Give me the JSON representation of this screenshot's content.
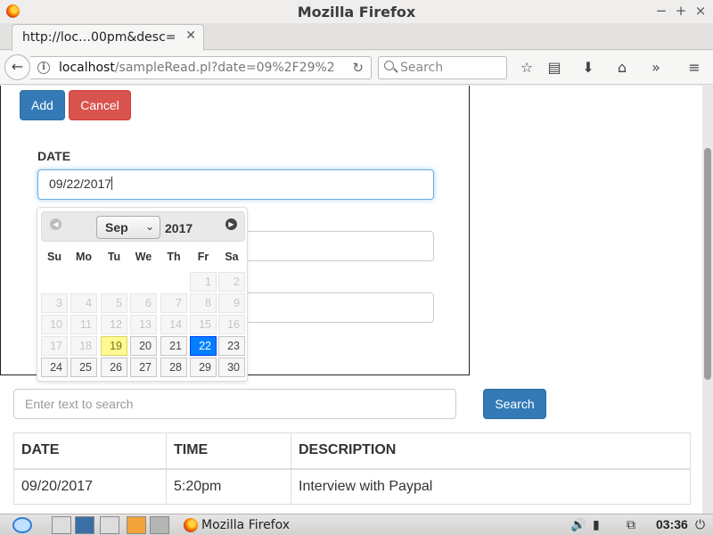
{
  "window": {
    "title": "Mozilla Firefox"
  },
  "tab": {
    "label": "http://loc…00pm&desc="
  },
  "urlbar": {
    "host": "localhost",
    "path": "/sampleRead.pl?date=09%2F29%2"
  },
  "searchbar": {
    "placeholder": "Search"
  },
  "form": {
    "add_label": "Add",
    "cancel_label": "Cancel",
    "date_label": "DATE",
    "date_value": "09/22/2017"
  },
  "datepicker": {
    "month": "Sep",
    "year": "2017",
    "weekdays": [
      "Su",
      "Mo",
      "Tu",
      "We",
      "Th",
      "Fr",
      "Sa"
    ],
    "rows": [
      [
        null,
        null,
        null,
        null,
        null,
        {
          "d": "1"
        },
        {
          "d": "2"
        }
      ],
      [
        {
          "d": "3"
        },
        {
          "d": "4"
        },
        {
          "d": "5"
        },
        {
          "d": "6"
        },
        {
          "d": "7"
        },
        {
          "d": "8"
        },
        {
          "d": "9"
        }
      ],
      [
        {
          "d": "10"
        },
        {
          "d": "11"
        },
        {
          "d": "12"
        },
        {
          "d": "13"
        },
        {
          "d": "14"
        },
        {
          "d": "15"
        },
        {
          "d": "16"
        }
      ],
      [
        {
          "d": "17"
        },
        {
          "d": "18"
        },
        {
          "d": "19",
          "state": "today"
        },
        {
          "d": "20",
          "state": "enabled"
        },
        {
          "d": "21",
          "state": "enabled"
        },
        {
          "d": "22",
          "state": "selected"
        },
        {
          "d": "23",
          "state": "enabled"
        }
      ],
      [
        {
          "d": "24",
          "state": "enabled"
        },
        {
          "d": "25",
          "state": "enabled"
        },
        {
          "d": "26",
          "state": "enabled"
        },
        {
          "d": "27",
          "state": "enabled"
        },
        {
          "d": "28",
          "state": "enabled"
        },
        {
          "d": "29",
          "state": "enabled"
        },
        {
          "d": "30",
          "state": "enabled"
        }
      ]
    ]
  },
  "search": {
    "placeholder": "Enter text to search",
    "button_label": "Search"
  },
  "table": {
    "headers": [
      "DATE",
      "TIME",
      "DESCRIPTION"
    ],
    "rows": [
      [
        "09/20/2017",
        "5:20pm",
        "Interview with Paypal"
      ]
    ]
  },
  "taskbar": {
    "task_label": "Mozilla Firefox",
    "clock": "03:36"
  },
  "colors": {
    "primary": "#337ab7",
    "danger": "#d9534f",
    "selected_day": "#007fff",
    "today_day": "#fffa90"
  }
}
